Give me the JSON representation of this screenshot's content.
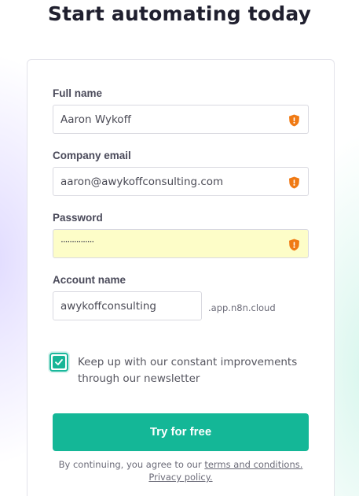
{
  "page": {
    "title": "Start automating today"
  },
  "form": {
    "full_name": {
      "label": "Full name",
      "value": "Aaron Wykoff"
    },
    "company_email": {
      "label": "Company email",
      "value": "aaron@awykoffconsulting.com"
    },
    "password": {
      "label": "Password",
      "value": "···············"
    },
    "account_name": {
      "label": "Account name",
      "value": "awykoffconsulting",
      "suffix": ".app.n8n.cloud"
    },
    "newsletter": {
      "checked": true,
      "label": "Keep up with our constant improvements through our newsletter"
    },
    "submit_label": "Try for free",
    "legal": {
      "prefix": "By continuing, you agree to our ",
      "terms_link": "terms and conditions.",
      "privacy_link": "Privacy policy."
    }
  },
  "icons": {
    "field_icon": "password-manager-shield-icon",
    "checkbox_icon": "checkmark-icon"
  },
  "colors": {
    "accent": "#14b797",
    "shield": "#f07a14",
    "autofill_bg": "#fdfdc8"
  }
}
